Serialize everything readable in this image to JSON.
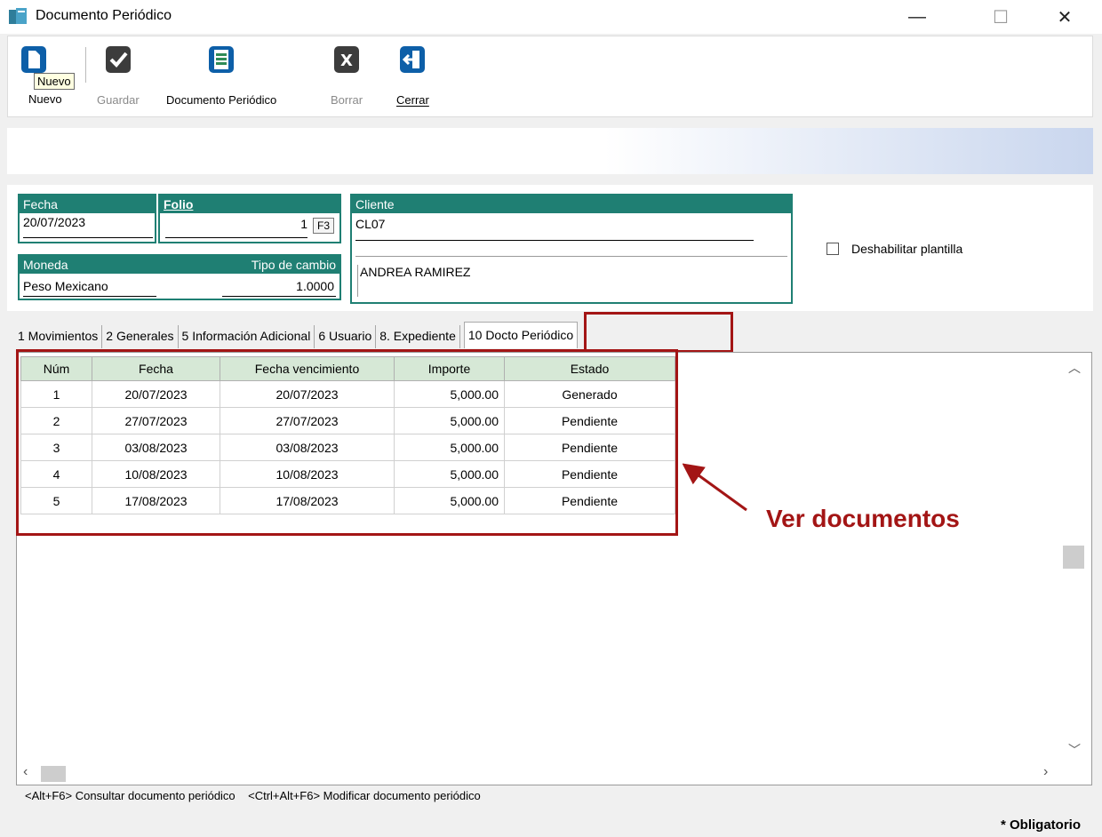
{
  "window": {
    "title": "Documento Periódico",
    "minimize": "—",
    "maximize": "☐",
    "close": "✕"
  },
  "toolbar": {
    "nuevo_label": "Nuevo",
    "guardar_label": "Guardar",
    "documento_label": "Documento Periódico",
    "borrar_label": "Borrar",
    "cerrar_label": "Cerrar",
    "tooltip": "Nuevo"
  },
  "header": {
    "fecha_label": "Fecha",
    "fecha_value": "20/07/2023",
    "folio_label": "Folio",
    "folio_value": "1",
    "folio_key": "F3",
    "moneda_label": "Moneda",
    "tipo_cambio_label": "Tipo de cambio",
    "moneda_value": "Peso Mexicano",
    "tipo_cambio_value": "1.0000",
    "cliente_label": "Cliente",
    "cliente_code": "CL07",
    "cliente_name": "ANDREA RAMIREZ",
    "deshabilitar_label": "Deshabilitar plantilla"
  },
  "tabs": [
    {
      "label": "1 Movimientos"
    },
    {
      "label": "2 Generales"
    },
    {
      "label": "5 Información Adicional"
    },
    {
      "label": "6 Usuario"
    },
    {
      "label": "8. Expediente"
    },
    {
      "label": "10 Docto Periódico"
    }
  ],
  "grid": {
    "columns": [
      "Núm",
      "Fecha",
      "Fecha vencimiento",
      "Importe",
      "Estado"
    ],
    "rows": [
      [
        "1",
        "20/07/2023",
        "20/07/2023",
        "5,000.00",
        "Generado"
      ],
      [
        "2",
        "27/07/2023",
        "27/07/2023",
        "5,000.00",
        "Pendiente"
      ],
      [
        "3",
        "03/08/2023",
        "03/08/2023",
        "5,000.00",
        "Pendiente"
      ],
      [
        "4",
        "10/08/2023",
        "10/08/2023",
        "5,000.00",
        "Pendiente"
      ],
      [
        "5",
        "17/08/2023",
        "17/08/2023",
        "5,000.00",
        "Pendiente"
      ]
    ]
  },
  "footer": {
    "hint": "<Alt+F6> Consultar documento periódico    <Ctrl+Alt+F6> Modificar documento periódico",
    "obligatorio": "* Obligatorio"
  },
  "annotation": {
    "callout": "Ver documentos"
  },
  "colors": {
    "header_teal": "#1f7f73",
    "highlight_red": "#a31515",
    "grid_header": "#d6e8d6"
  }
}
